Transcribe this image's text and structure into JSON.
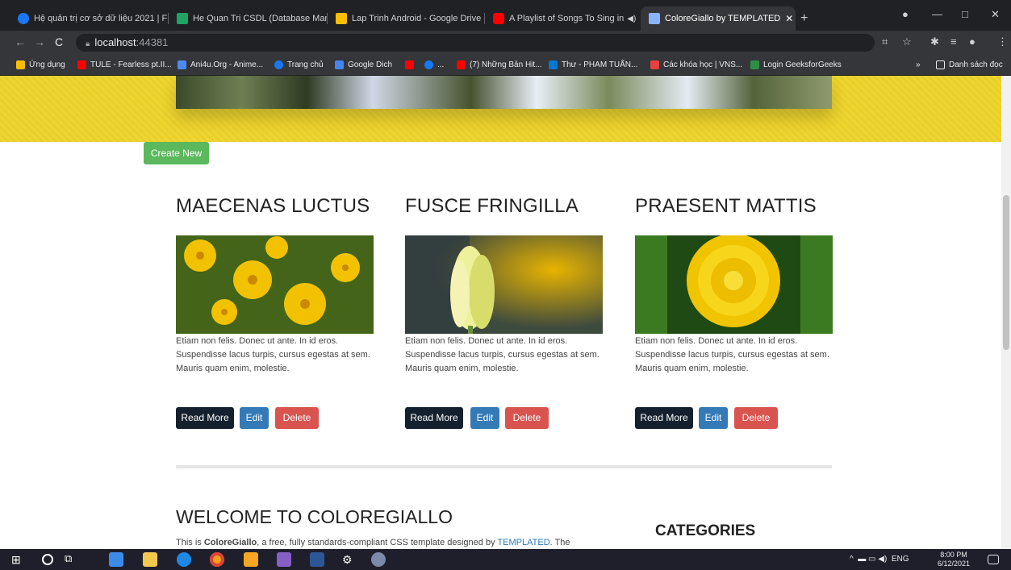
{
  "browser": {
    "tabs": [
      {
        "title": "Hệ quản trị cơ sở dữ liệu 2021 | F",
        "fav_color": "#1877f2"
      },
      {
        "title": "He Quan Tri CSDL (Database Man",
        "fav_color": "#1fa463"
      },
      {
        "title": "Lap Trinh Android - Google Drive",
        "fav_color": "#fbbc04"
      },
      {
        "title": "A Playlist of Songs To Sing in",
        "fav_color": "#ff0000"
      },
      {
        "title": "ColoreGiallo by TEMPLATED",
        "fav_color": "#8ab4f8"
      }
    ],
    "new_tab": "+",
    "url_host": "localhost",
    "url_port": ":44381",
    "bookmarks": [
      {
        "label": "Ứng dụng",
        "color": "#fbbc04"
      },
      {
        "label": "TULE - Fearless pt.II...",
        "color": "#ff0000"
      },
      {
        "label": "Ani4u.Org - Anime...",
        "color": "#4c8bf5"
      },
      {
        "label": "Trang chủ",
        "color": "#1877f2"
      },
      {
        "label": "Google Dich",
        "color": "#4285f4"
      },
      {
        "label": "",
        "color": "#ff0000"
      },
      {
        "label": "...",
        "color": "#1877f2"
      },
      {
        "label": "(7) Những Bản Hit...",
        "color": "#ff0000"
      },
      {
        "label": "Thư - PHAM TUẤN...",
        "color": "#0078d4"
      },
      {
        "label": "Các khóa học | VNS...",
        "color": "#e8423f"
      },
      {
        "label": "Login GeeksforGeeks",
        "color": "#2f8d46"
      }
    ],
    "bookmarks_more": "»",
    "reading_list": "Danh sách đọc"
  },
  "page": {
    "create_new": "Create New",
    "posts": [
      {
        "title": "MAECENAS LUCTUS",
        "body": "Etiam non felis. Donec ut ante. In id eros. Suspendisse lacus turpis, cursus egestas at sem. Mauris quam enim, molestie.",
        "image": "yellow-daisies-photo"
      },
      {
        "title": "FUSCE FRINGILLA",
        "body": "Etiam non felis. Donec ut ante. In id eros. Suspendisse lacus turpis, cursus egestas at sem. Mauris quam enim, molestie.",
        "image": "yellow-tulip-photo"
      },
      {
        "title": "PRAESENT MATTIS",
        "body": "Etiam non felis. Donec ut ante. In id eros. Suspendisse lacus turpis, cursus egestas at sem. Mauris quam enim, molestie.",
        "image": "marigold-photo"
      }
    ],
    "read_more": "Read More",
    "edit": "Edit",
    "delete": "Delete",
    "welcome_title": "WELCOME TO COLOREGIALLO",
    "intro_prefix": "This is ",
    "intro_brand": "ColoreGiallo",
    "intro_middle": ", a free, fully standards-compliant CSS template designed by ",
    "intro_link": "TEMPLATED",
    "intro_suffix": ". The",
    "categories_title": "CATEGORIES"
  },
  "taskbar": {
    "language": "ENG",
    "time": "8:00 PM",
    "date": "6/12/2021"
  },
  "colors": {
    "accent_yellow": "#eed530",
    "create_green": "#5cb85c",
    "read_more_navy": "#15202e",
    "edit_blue": "#337ab7",
    "delete_red": "#d9534f",
    "link_blue": "#2a7ab8"
  }
}
